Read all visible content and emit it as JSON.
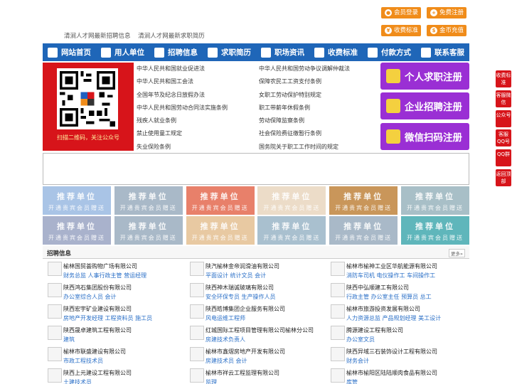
{
  "top_links": [
    "清涧人才网最新招聘信息",
    "清涧人才网最新求职简历"
  ],
  "top_buttons": [
    {
      "label": "会员登录",
      "icon": "user-icon"
    },
    {
      "label": "免费注册",
      "icon": "user-add-icon"
    },
    {
      "label": "收费标准",
      "icon": "yen-icon"
    },
    {
      "label": "金币充值",
      "icon": "coin-icon"
    }
  ],
  "nav": [
    {
      "label": "网站首页",
      "icon": "home-icon"
    },
    {
      "label": "用人单位",
      "icon": "building-icon"
    },
    {
      "label": "招聘信息",
      "icon": "megaphone-icon"
    },
    {
      "label": "求职简历",
      "icon": "search-icon"
    },
    {
      "label": "职场资讯",
      "icon": "news-icon"
    },
    {
      "label": "收费标准",
      "icon": "yen-icon"
    },
    {
      "label": "付款方式",
      "icon": "card-icon"
    },
    {
      "label": "联系客服",
      "icon": "phone-icon"
    }
  ],
  "qr_caption": "扫描二维码，关注公众号",
  "policy_left": [
    "中华人民共和国就业促进法",
    "中华人民共和国工会法",
    "全国年节及纪念日放假办法",
    "中华人民共和国劳动合同法实施条例",
    "残疾人就业条例",
    "禁止使用童工规定",
    "失业保险条例"
  ],
  "policy_right": [
    "中华人民共和国劳动争议调解仲裁法",
    "保障农民工工资支付条例",
    "女职工劳动保护特别规定",
    "职工带薪年休假条例",
    "劳动保障监察条例",
    "社会保险费征缴暂行条例",
    "国务院关于职工工作时间的规定"
  ],
  "register_buttons": [
    "个人求职注册",
    "企业招聘注册",
    "微信扫码注册"
  ],
  "cards": {
    "title": "推荐单位",
    "subtitle": "开通贵宾会员赠送"
  },
  "card_colors": [
    "#a9c4e6",
    "#a9b9c8",
    "#e8806a",
    "#ecdcc8",
    "#c9965a",
    "#a8bfc7",
    "#a9b2cc",
    "#a9b9c8",
    "#e8c9a2",
    "#a9c0cf",
    "#a9b9c8",
    "#5fb6bb"
  ],
  "jobs_section": {
    "title": "招聘信息",
    "more": "更多»"
  },
  "jobs": [
    {
      "company": "榆林国贸荟购物广场有限公司",
      "roles": "财务总监 人事行政主管 营运经理"
    },
    {
      "company": "陕汽榆林金帝润滑油有限公司",
      "roles": "平面设计 统计文员 会计"
    },
    {
      "company": "榆林市榆神工业区华航能源有限公司",
      "roles": "消防车司机 电仪操作工 车间操作工"
    },
    {
      "company": "陕西鸿石集团股份有限公司",
      "roles": "办公室综合人员 会计"
    },
    {
      "company": "陕西神木瑞诚玻璃有限公司",
      "roles": "安全环保专员 生产操作人员"
    },
    {
      "company": "陕西中弘顺建工有限公司",
      "roles": "行政主管 办公室主任 预算员 总工"
    },
    {
      "company": "陕西宏宇矿业建设有限公司",
      "roles": "房地产开发经理 工程资料员 施工员"
    },
    {
      "company": "陕西皓博集团企业服务有限公司",
      "roles": "风电运维工程师"
    },
    {
      "company": "榆林市旅游投资发展有限公司",
      "roles": "人力资源总监 产品规划经理 美工设计"
    },
    {
      "company": "陕西晟卓建筑工程有限公司",
      "roles": "建筑"
    },
    {
      "company": "红城国际工程项目管理有限公司榆林分公司",
      "roles": "房建技术负责人"
    },
    {
      "company": "腾源建设工程有限公司",
      "roles": "办公室文员"
    },
    {
      "company": "榆林市联盛建设有限公司",
      "roles": "市政工程技术员"
    },
    {
      "company": "榆林市鑫熠房地产开发有限公司",
      "roles": "房建技术员 会计"
    },
    {
      "company": "陕西异域三石装饰设计工程有限公司",
      "roles": "财务会计"
    },
    {
      "company": "陕西上元建设工程有限公司",
      "roles": "土建技术员"
    },
    {
      "company": "榆林市祥云工程监理有限公司",
      "roles": "监理"
    },
    {
      "company": "榆林市榆阳区陆陆顺肉食品有限公司",
      "roles": "库管"
    }
  ],
  "side_tabs": [
    "收费标准",
    "客服微信",
    "公众号",
    "客服QQ号",
    "QQ群",
    "返回顶部"
  ]
}
